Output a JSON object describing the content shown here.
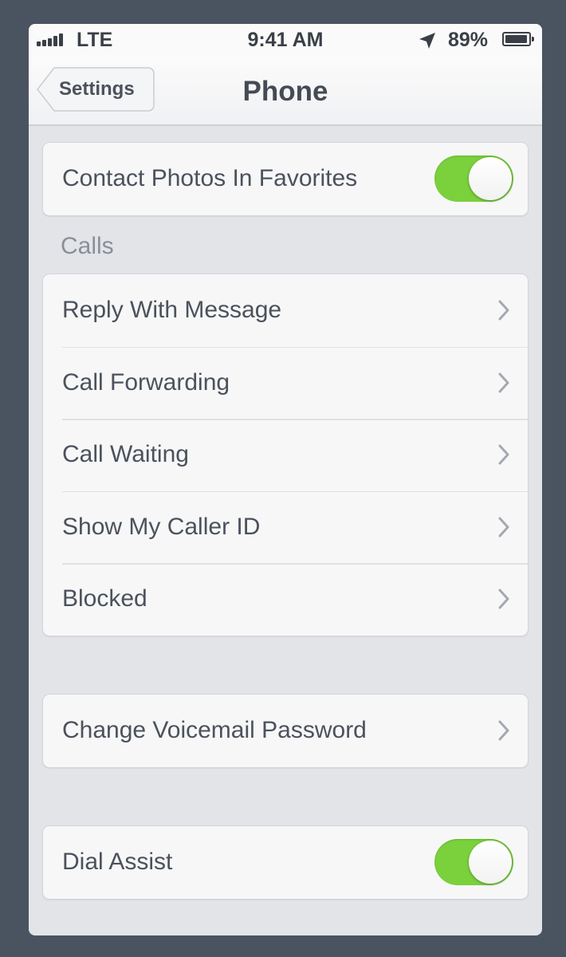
{
  "status_bar": {
    "carrier": "LTE",
    "time": "9:41 AM",
    "battery": "89%",
    "battery_level": 0.89,
    "icons": [
      "signal-bars-icon",
      "location-arrow-icon",
      "battery-icon"
    ]
  },
  "nav": {
    "back_label": "Settings",
    "title": "Phone"
  },
  "groups": {
    "favorites": {
      "label": "Contact Photos In Favorites",
      "toggle_on": true
    },
    "calls_header": "Calls",
    "calls": [
      {
        "label": "Reply With Message"
      },
      {
        "label": "Call Forwarding"
      },
      {
        "label": "Call Waiting"
      },
      {
        "label": "Show My Caller ID"
      },
      {
        "label": "Blocked"
      }
    ],
    "voicemail": {
      "label": "Change Voicemail Password"
    },
    "dial_assist": {
      "label": "Dial Assist",
      "toggle_on": true
    }
  },
  "colors": {
    "accent_toggle": "#7ad13c",
    "background": "#e2e4e8",
    "frame": "#4a5461"
  }
}
